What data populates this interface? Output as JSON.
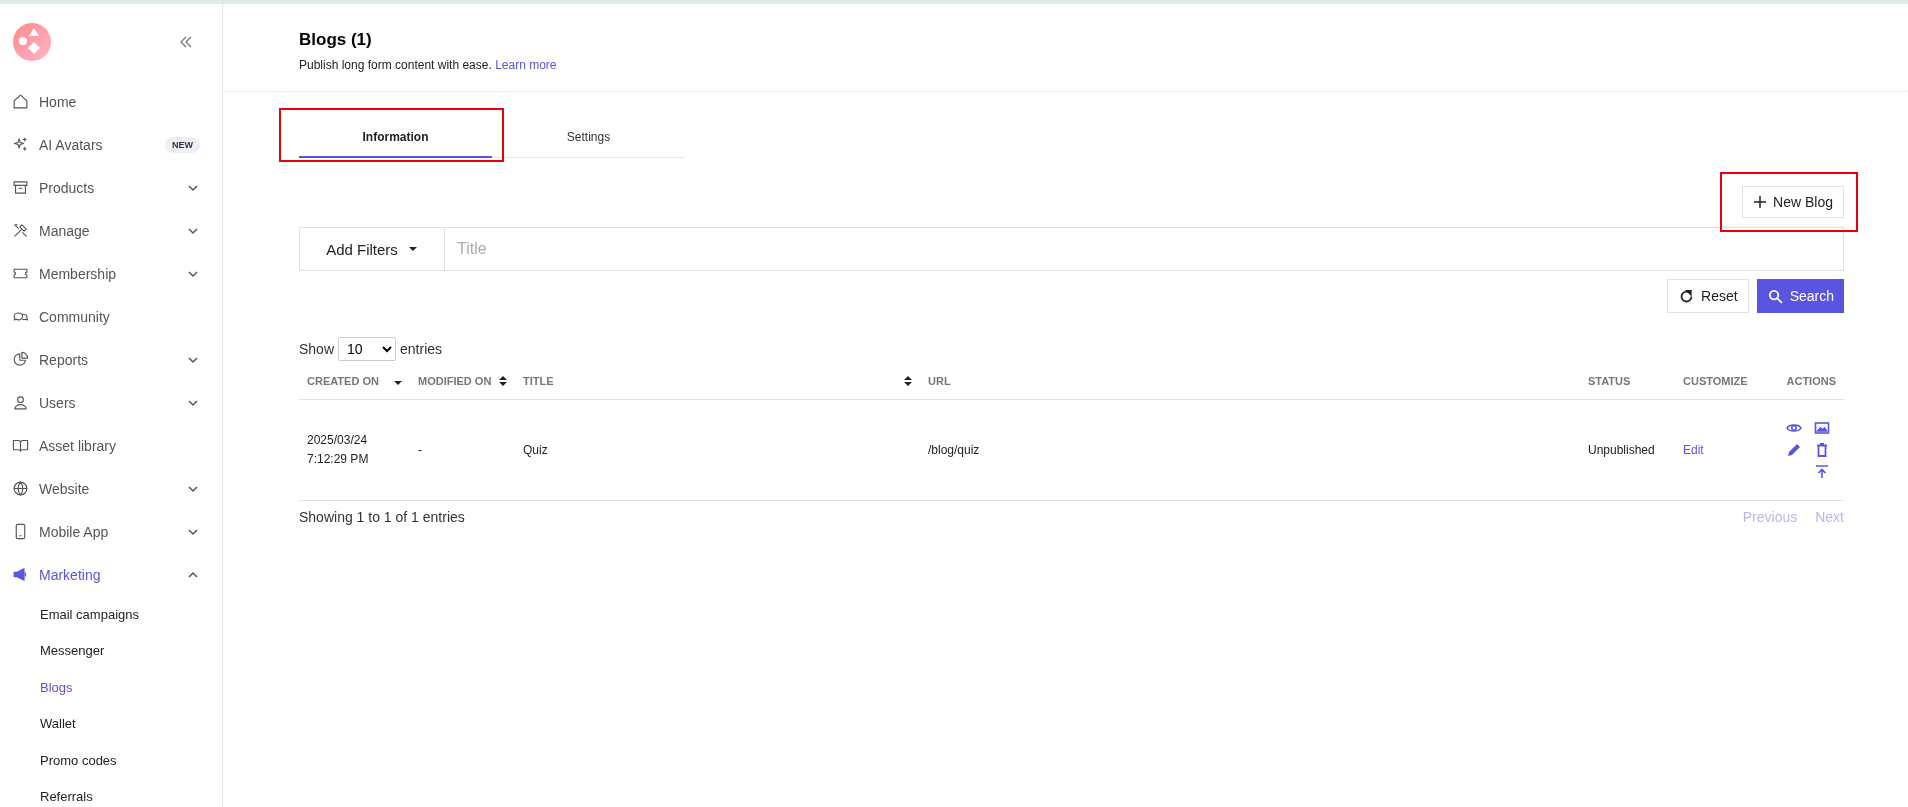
{
  "sidebar": {
    "items": [
      {
        "label": "Home",
        "selected": false
      },
      {
        "label": "AI Avatars",
        "selected": false,
        "badge": "NEW"
      },
      {
        "label": "Products",
        "selected": false,
        "expanded": false
      },
      {
        "label": "Manage",
        "selected": false,
        "expanded": false
      },
      {
        "label": "Membership",
        "selected": false,
        "expanded": false
      },
      {
        "label": "Community",
        "selected": false
      },
      {
        "label": "Reports",
        "selected": false,
        "expanded": false
      },
      {
        "label": "Users",
        "selected": false,
        "expanded": false
      },
      {
        "label": "Asset library",
        "selected": false
      },
      {
        "label": "Website",
        "selected": false,
        "expanded": false
      },
      {
        "label": "Mobile App",
        "selected": false,
        "expanded": false
      },
      {
        "label": "Marketing",
        "selected": true,
        "expanded": true,
        "children": [
          {
            "label": "Email campaigns",
            "selected": false
          },
          {
            "label": "Messenger",
            "selected": false
          },
          {
            "label": "Blogs",
            "selected": true
          },
          {
            "label": "Wallet",
            "selected": false
          },
          {
            "label": "Promo codes",
            "selected": false
          },
          {
            "label": "Referrals",
            "selected": false
          }
        ]
      }
    ]
  },
  "header": {
    "title": "Blogs (1)",
    "subtitle": "Publish long form content with ease.",
    "link": "Learn more"
  },
  "tabs": [
    {
      "label": "Information",
      "selected": true,
      "highlighted": true
    },
    {
      "label": "Settings",
      "selected": false,
      "highlighted": false
    }
  ],
  "new_button": {
    "label": "New Blog",
    "highlighted": true
  },
  "filters": {
    "dropdown": "Add Filters",
    "placeholder": "Title"
  },
  "buttons": {
    "reset": "Reset",
    "search": "Search"
  },
  "entries": {
    "show": "Show",
    "value": "10",
    "suffix": "entries"
  },
  "table": {
    "columns": [
      {
        "label": "CREATED ON",
        "kind": "sorted_desc"
      },
      {
        "label": "MODIFIED ON",
        "kind": "sortable"
      },
      {
        "label": "TITLE",
        "kind": "sortable"
      },
      {
        "label": "URL"
      },
      {
        "label": "STATUS"
      },
      {
        "label": "CUSTOMIZE"
      },
      {
        "label": "ACTIONS"
      }
    ],
    "rows": [
      {
        "created_on": [
          "2025/03/24",
          "7:12:29 PM"
        ],
        "modified_on": "-",
        "title": "Quiz",
        "url": "/blog/quiz",
        "status": "Unpublished",
        "customize": "Edit"
      }
    ]
  },
  "footer": {
    "info": "Showing 1 to 1 of 1 entries",
    "pagination": [
      {
        "label": "Previous",
        "disabled": true
      },
      {
        "label": "Next",
        "disabled": true
      }
    ]
  }
}
